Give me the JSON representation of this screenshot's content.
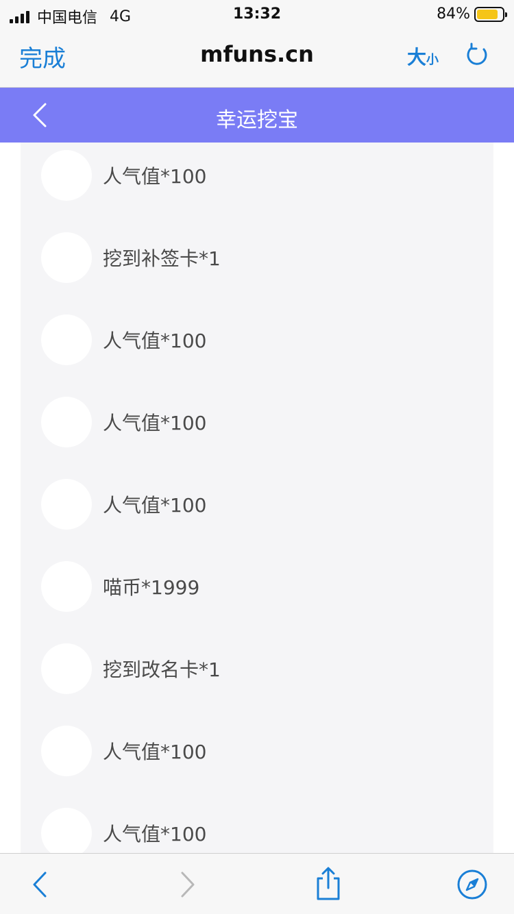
{
  "status": {
    "carrier": "中国电信",
    "network": "4G",
    "time": "13:32",
    "battery_percent": "84%",
    "battery_level": 0.84,
    "battery_color": "#f5c518"
  },
  "browser": {
    "done_label": "完成",
    "url": "mfuns.cn",
    "text_size_big": "大",
    "text_size_small": "小",
    "accent_color": "#1a7fd6",
    "icons": [
      "reload-icon",
      "back-arrow-icon",
      "forward-arrow-icon",
      "share-icon",
      "compass-icon"
    ]
  },
  "app": {
    "title": "幸运挖宝",
    "header_color": "#7a7cf5",
    "back_icon": "chevron-left-icon"
  },
  "prizes": [
    {
      "label": "人气值*100"
    },
    {
      "label": "挖到补签卡*1"
    },
    {
      "label": "人气值*100"
    },
    {
      "label": "人气值*100"
    },
    {
      "label": "人气值*100"
    },
    {
      "label": "喵币*1999"
    },
    {
      "label": "挖到改名卡*1"
    },
    {
      "label": "人气值*100"
    },
    {
      "label": "人气值*100"
    }
  ]
}
